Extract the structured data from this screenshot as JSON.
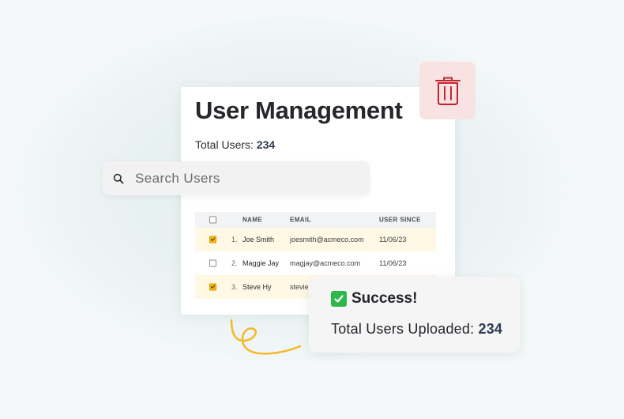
{
  "card": {
    "title": "User Management",
    "total_label": "Total Users:",
    "total_value": "234"
  },
  "search": {
    "placeholder": "Search Users",
    "icon": "search-icon"
  },
  "table": {
    "columns": [
      "NAME",
      "EMAIL",
      "USER SINCE"
    ],
    "rows": [
      {
        "index": "1.",
        "name": "Joe Smith",
        "email": "joesmith@acmeco.com",
        "since": "11/06/23",
        "checked": true
      },
      {
        "index": "2.",
        "name": "Maggie Jay",
        "email": "magjay@acmeco.com",
        "since": "11/06/23",
        "checked": false
      },
      {
        "index": "3.",
        "name": "Steve Hy",
        "email": "stevie",
        "since": "",
        "checked": true
      }
    ]
  },
  "trash": {
    "icon": "trash-icon"
  },
  "toast": {
    "icon": "check-mark-icon",
    "title": "Success!",
    "body_label": "Total Users Uploaded:",
    "body_value": "234"
  },
  "colors": {
    "checkbox_checked": "#f3b718",
    "row_selected": "#fff8e4",
    "trash_bg": "#f9e2e2",
    "trash_icon": "#c0262d",
    "success_green": "#2eb84b",
    "squiggle": "#f2b928"
  }
}
